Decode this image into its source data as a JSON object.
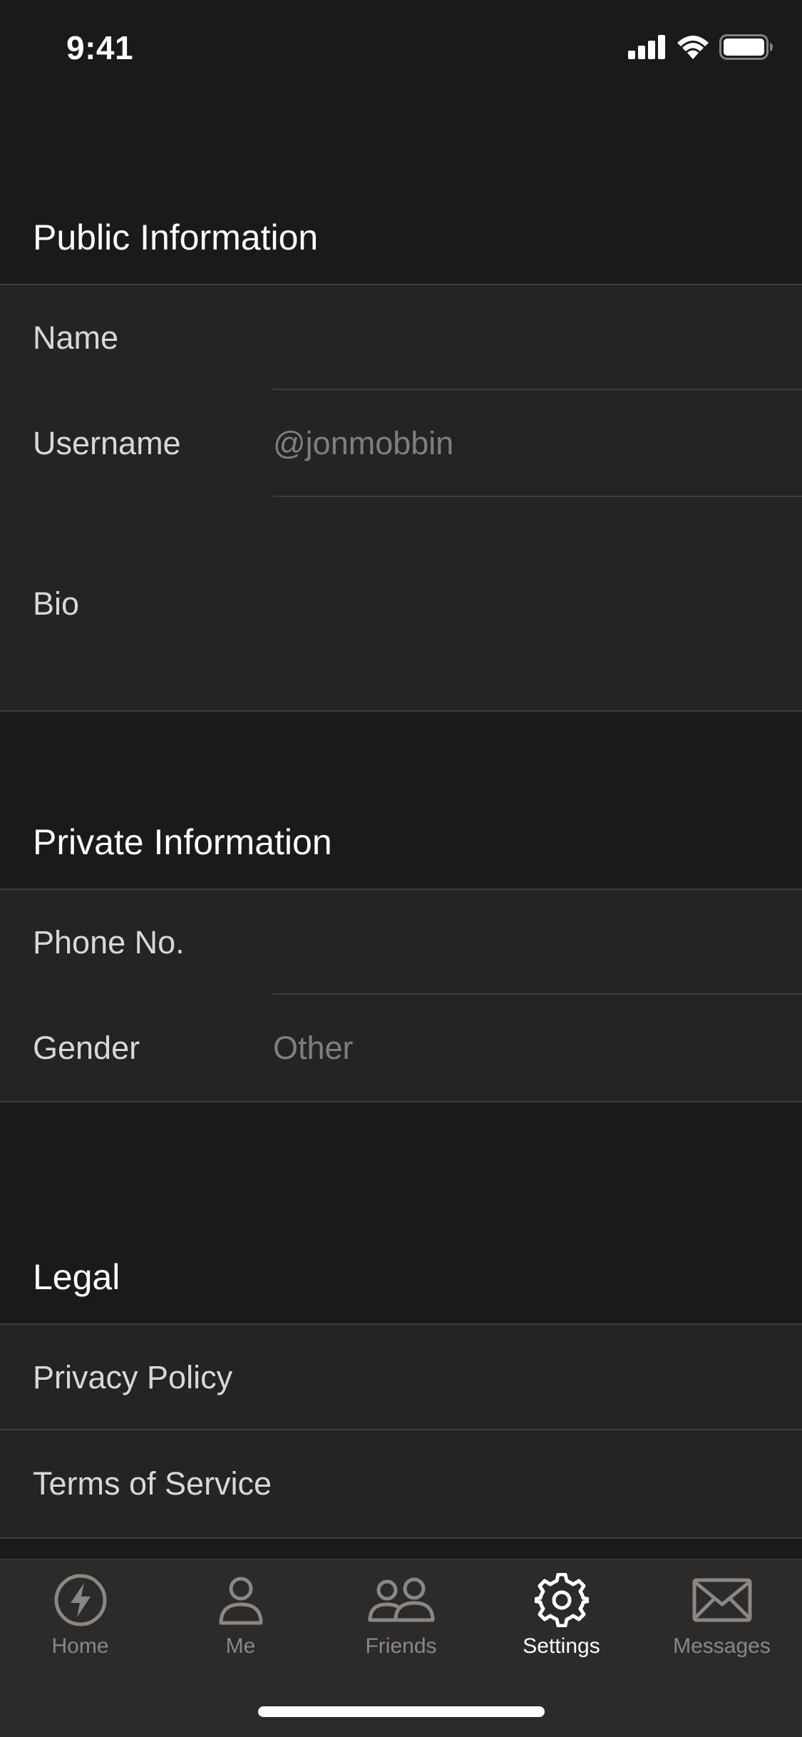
{
  "status_bar": {
    "time": "9:41"
  },
  "sections": {
    "public": {
      "title": "Public Information",
      "name_label": "Name",
      "name_value": "",
      "username_label": "Username",
      "username_value": "@jonmobbin",
      "bio_label": "Bio",
      "bio_value": ""
    },
    "private": {
      "title": "Private Information",
      "phone_label": "Phone No.",
      "phone_value": "",
      "gender_label": "Gender",
      "gender_value": "Other"
    },
    "legal": {
      "title": "Legal",
      "privacy_label": "Privacy Policy",
      "terms_label": "Terms of Service"
    }
  },
  "tab_bar": {
    "active": "Settings",
    "tabs": [
      {
        "label": "Home",
        "icon": "lightning-icon"
      },
      {
        "label": "Me",
        "icon": "person-icon"
      },
      {
        "label": "Friends",
        "icon": "people-icon"
      },
      {
        "label": "Settings",
        "icon": "gear-icon"
      },
      {
        "label": "Messages",
        "icon": "envelope-icon"
      }
    ]
  },
  "colors": {
    "background": "#1a1a19",
    "cell_background": "#242424",
    "tab_bar_background": "#2d2b29",
    "active_tab": "#ffffff",
    "inactive_tab": "#8a8785"
  }
}
